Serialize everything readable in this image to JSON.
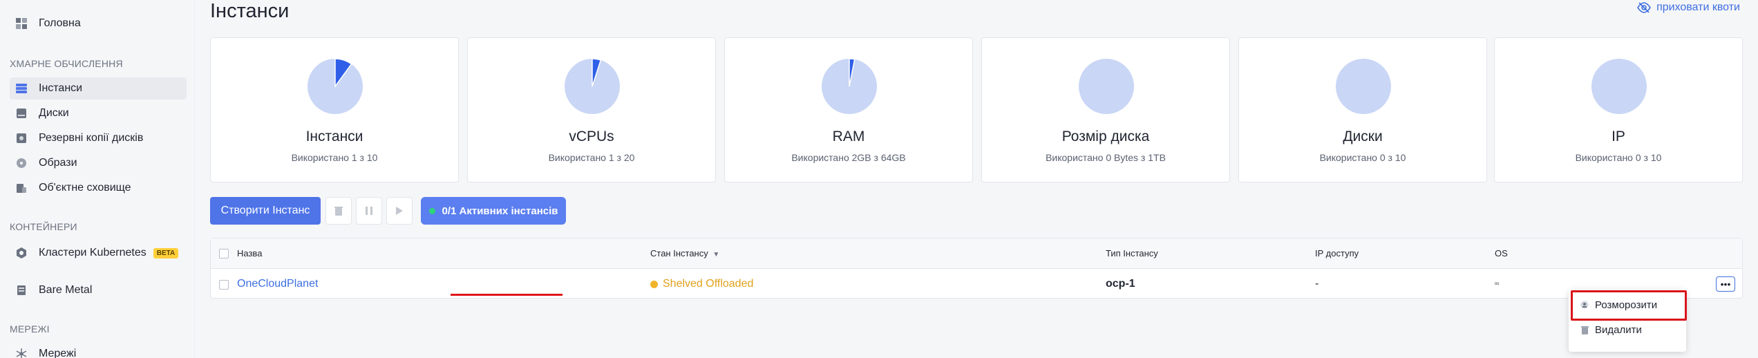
{
  "sidebar": {
    "home": "Головна",
    "section_cloud": "ХМАРНЕ ОБЧИСЛЕННЯ",
    "instances": "Інстанси",
    "disks": "Диски",
    "backups": "Резервні копії дисків",
    "images": "Образи",
    "object_storage": "Об'єктне сховище",
    "section_containers": "КОНТЕЙНЕРИ",
    "kubernetes": "Кластери Kubernetes",
    "beta": "BETA",
    "bare_metal": "Bare Metal",
    "section_networks": "МЕРЕЖІ",
    "networks": "Мережі"
  },
  "header": {
    "title": "Інстанси",
    "hide_quotas": "приховати квоти"
  },
  "quotas": [
    {
      "title": "Інстанси",
      "sub": "Використано 1 з 10",
      "fraction": 0.1
    },
    {
      "title": "vCPUs",
      "sub": "Використано 1 з 20",
      "fraction": 0.05
    },
    {
      "title": "RAM",
      "sub": "Використано 2GB з 64GB",
      "fraction": 0.031
    },
    {
      "title": "Розмір диска",
      "sub": "Використано 0 Bytes з 1TB",
      "fraction": 0
    },
    {
      "title": "Диски",
      "sub": "Використано 0 з 10",
      "fraction": 0
    },
    {
      "title": "IP",
      "sub": "Використано 0 з 10",
      "fraction": 0
    }
  ],
  "toolbar": {
    "create": "Створити Інстанс",
    "active": "0/1 Активних інстансів"
  },
  "table": {
    "headers": {
      "name": "Назва",
      "state": "Стан Інстансу",
      "type": "Тип Інстансу",
      "ip": "IP доступу",
      "os": "OS"
    },
    "row": {
      "name": "OneCloudPlanet",
      "state": "Shelved Offloaded",
      "type": "ocp-1",
      "ip": "-",
      "os": "os"
    }
  },
  "menu": {
    "unshelve": "Розморозити",
    "delete": "Видалити"
  },
  "colors": {
    "accent": "#4f74e8",
    "status_warning": "#f0b429",
    "pie_used": "#2f5fe8",
    "pie_free": "#c9d6f5",
    "highlight": "#d9141a"
  }
}
